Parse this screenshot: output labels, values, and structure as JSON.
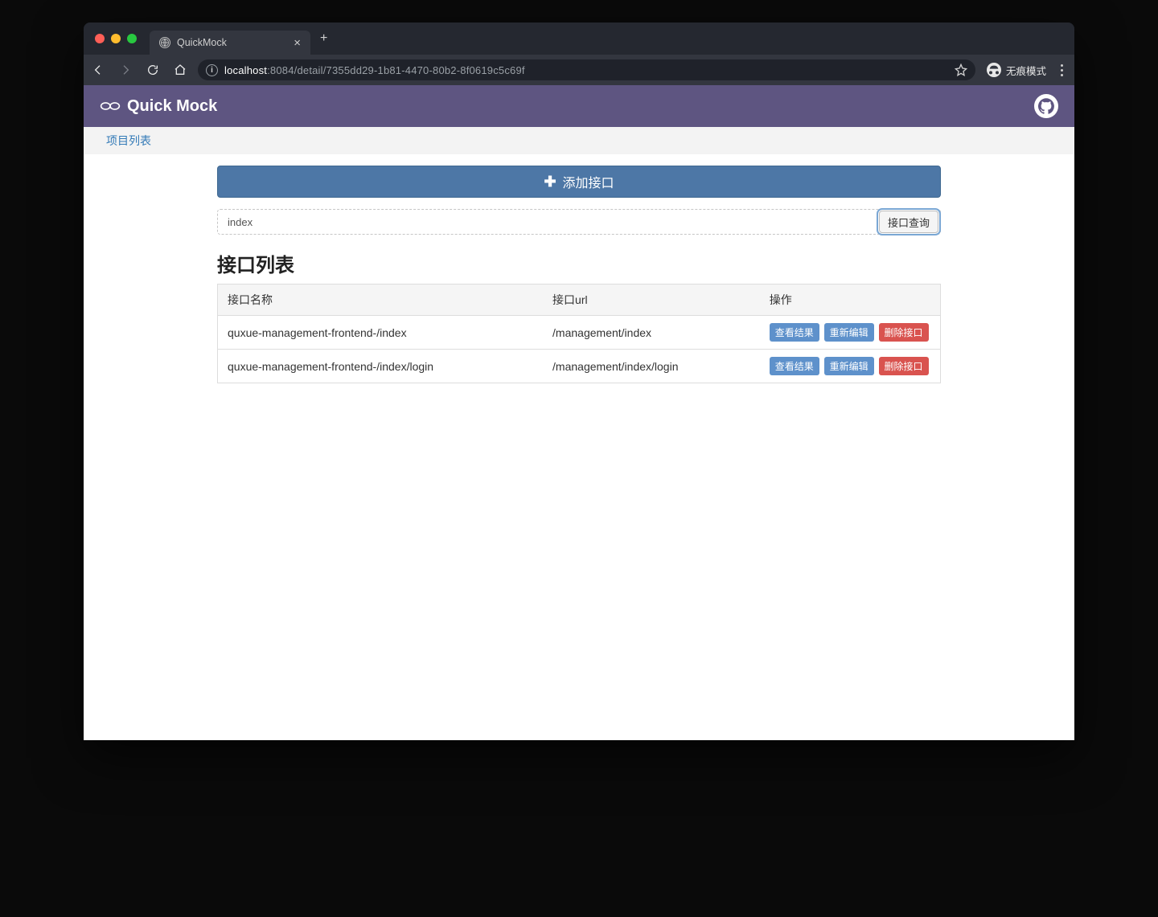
{
  "browser": {
    "tab_title": "QuickMock",
    "url_pre": "localhost",
    "url_port_path": ":8084/detail/7355dd29-1b81-4470-80b2-8f0619c5c69f",
    "incognito_label": "无痕模式"
  },
  "header": {
    "brand": "Quick Mock"
  },
  "breadcrumb": {
    "project_list": "项目列表"
  },
  "actions": {
    "add_api": "添加接口",
    "search_btn": "接口查询"
  },
  "search": {
    "value": "index"
  },
  "section": {
    "title": "接口列表"
  },
  "table": {
    "headers": {
      "name": "接口名称",
      "url": "接口url",
      "ops": "操作"
    },
    "ops_labels": {
      "view": "查看结果",
      "edit": "重新编辑",
      "delete": "删除接口"
    },
    "rows": [
      {
        "name": "quxue-management-frontend-/index",
        "url": "/management/index"
      },
      {
        "name": "quxue-management-frontend-/index/login",
        "url": "/management/index/login"
      }
    ]
  }
}
